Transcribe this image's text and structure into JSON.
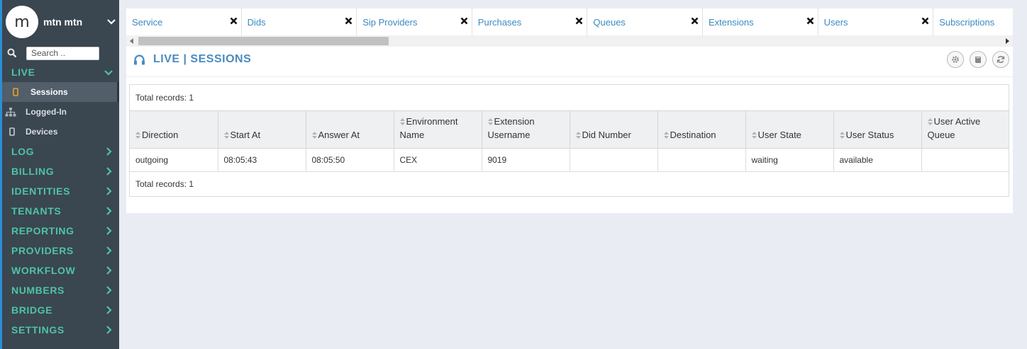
{
  "user": {
    "avatar_letter": "m",
    "name": "mtn mtn"
  },
  "search": {
    "placeholder": "Search .."
  },
  "sidebar": {
    "live": {
      "label": "LIVE",
      "items": [
        {
          "label": "Sessions",
          "icon": "mobile-icon"
        },
        {
          "label": "Logged-In",
          "icon": "sitemap-icon"
        },
        {
          "label": "Devices",
          "icon": "mobile-icon"
        }
      ]
    },
    "sections": [
      {
        "label": "LOG"
      },
      {
        "label": "BILLING"
      },
      {
        "label": "IDENTITIES"
      },
      {
        "label": "TENANTS"
      },
      {
        "label": "REPORTING"
      },
      {
        "label": "PROVIDERS"
      },
      {
        "label": "WORKFLOW"
      },
      {
        "label": "NUMBERS"
      },
      {
        "label": "BRIDGE"
      },
      {
        "label": "SETTINGS"
      }
    ]
  },
  "tabs": [
    {
      "label": "Service"
    },
    {
      "label": "Dids"
    },
    {
      "label": "Sip Providers"
    },
    {
      "label": "Purchases"
    },
    {
      "label": "Queues"
    },
    {
      "label": "Extensions"
    },
    {
      "label": "Users"
    },
    {
      "label": "Subscriptions"
    }
  ],
  "panel": {
    "title": "LIVE | SESSIONS",
    "buttons": [
      "gear-icon",
      "book-icon",
      "refresh-icon"
    ]
  },
  "table": {
    "total_top": "Total records: 1",
    "total_bottom": "Total records: 1",
    "columns": [
      {
        "line1": "Direction",
        "line2": ""
      },
      {
        "line1": "Start At",
        "line2": ""
      },
      {
        "line1": "Answer At",
        "line2": ""
      },
      {
        "line1": "Environment",
        "line2": "Name"
      },
      {
        "line1": "Extension",
        "line2": "Username"
      },
      {
        "line1": "Did Number",
        "line2": ""
      },
      {
        "line1": "Destination",
        "line2": ""
      },
      {
        "line1": "User State",
        "line2": ""
      },
      {
        "line1": "User Status",
        "line2": ""
      },
      {
        "line1": "User Active",
        "line2": "Queue"
      }
    ],
    "rows": [
      [
        "outgoing",
        "08:05:43",
        "08:05:50",
        "CEX",
        "9019",
        "",
        "",
        "waiting",
        "available",
        ""
      ]
    ]
  },
  "colors": {
    "accent": "#4fc3a4",
    "sidebar_bg": "#3a4650",
    "link": "#3b8bc0",
    "title": "#4a8bc0",
    "active_icon": "#f0a020"
  }
}
